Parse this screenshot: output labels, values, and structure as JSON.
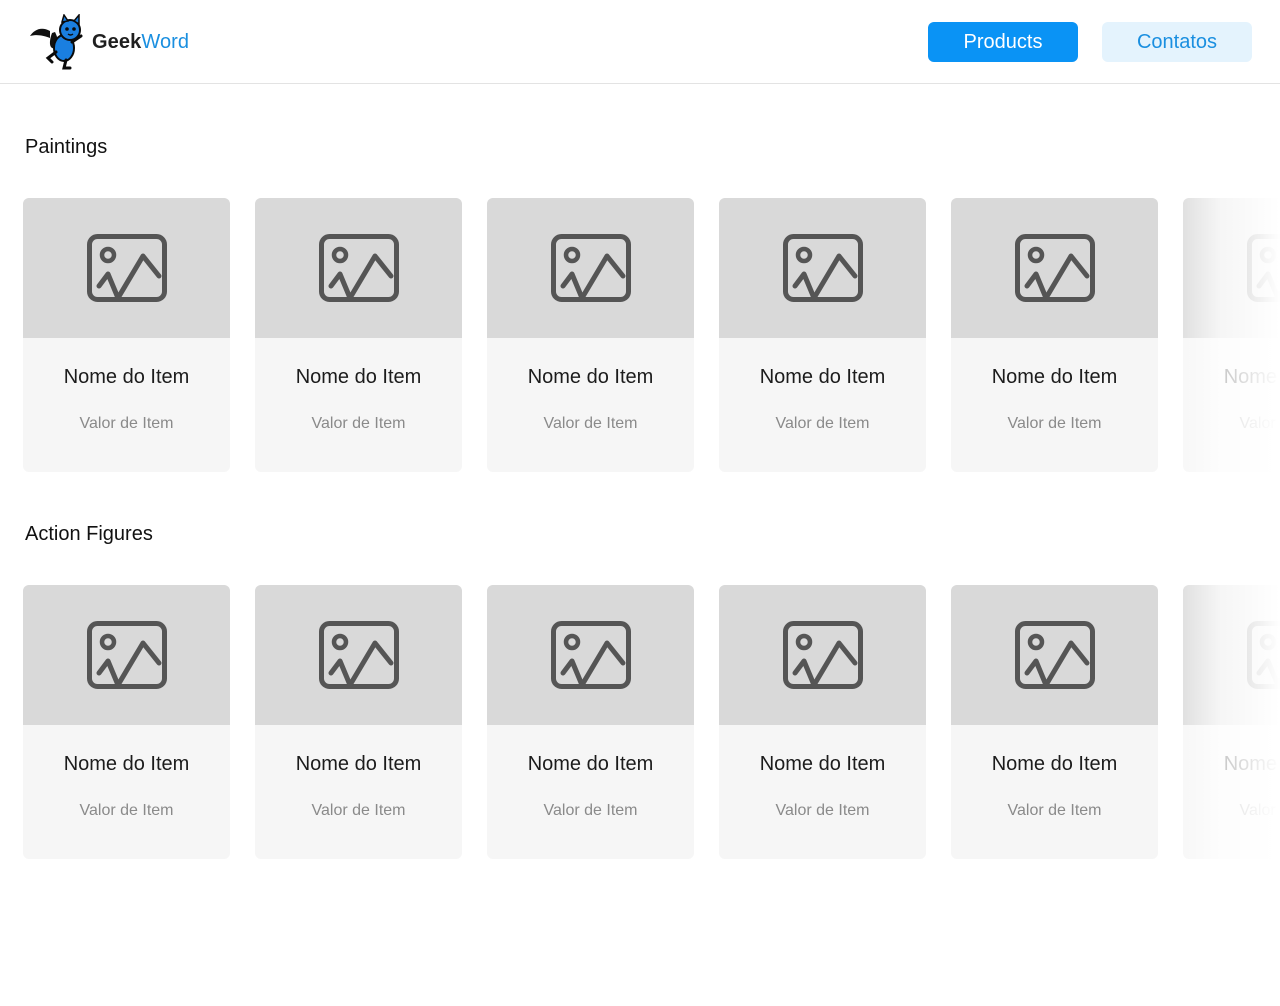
{
  "header": {
    "logo": {
      "icon": "cat-mascot-icon",
      "text_bold": "Geek",
      "text_accent": "Word"
    },
    "nav": {
      "products_label": "Products",
      "contacts_label": "Contatos"
    }
  },
  "colors": {
    "accent": "#0a93f5",
    "accent_light": "#e4f3fd",
    "card_bg": "#f6f6f6",
    "image_placeholder": "#d9d9d9"
  },
  "sections": [
    {
      "title": "Paintings",
      "items": [
        {
          "name": "Nome do Item",
          "value": "Valor de Item",
          "icon": "image-placeholder-icon"
        },
        {
          "name": "Nome do Item",
          "value": "Valor de Item",
          "icon": "image-placeholder-icon"
        },
        {
          "name": "Nome do Item",
          "value": "Valor de Item",
          "icon": "image-placeholder-icon"
        },
        {
          "name": "Nome do Item",
          "value": "Valor de Item",
          "icon": "image-placeholder-icon"
        },
        {
          "name": "Nome do Item",
          "value": "Valor de Item",
          "icon": "image-placeholder-icon"
        },
        {
          "name": "Nome do Item",
          "value": "Valor de Item",
          "icon": "image-placeholder-icon"
        }
      ]
    },
    {
      "title": "Action Figures",
      "items": [
        {
          "name": "Nome do Item",
          "value": "Valor de Item",
          "icon": "image-placeholder-icon"
        },
        {
          "name": "Nome do Item",
          "value": "Valor de Item",
          "icon": "image-placeholder-icon"
        },
        {
          "name": "Nome do Item",
          "value": "Valor de Item",
          "icon": "image-placeholder-icon"
        },
        {
          "name": "Nome do Item",
          "value": "Valor de Item",
          "icon": "image-placeholder-icon"
        },
        {
          "name": "Nome do Item",
          "value": "Valor de Item",
          "icon": "image-placeholder-icon"
        },
        {
          "name": "Nome do Item",
          "value": "Valor de Item",
          "icon": "image-placeholder-icon"
        }
      ]
    }
  ]
}
